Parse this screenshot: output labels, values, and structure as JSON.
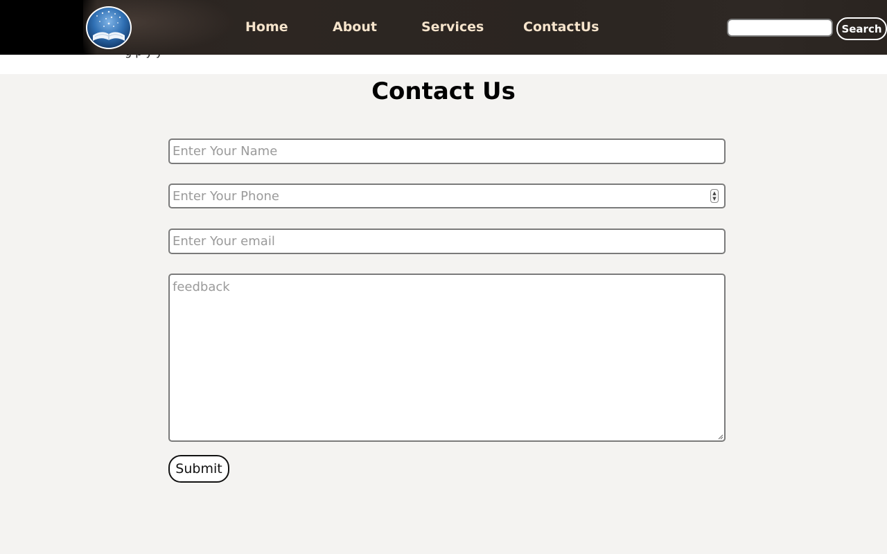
{
  "header": {
    "logo_icon": "open-book-logo-icon",
    "nav": [
      {
        "label": "Home"
      },
      {
        "label": "About"
      },
      {
        "label": "Services"
      },
      {
        "label": "ContactUs"
      }
    ],
    "search": {
      "value": "",
      "placeholder": "",
      "button_label": "Search"
    },
    "text_color": "#f6e4cc"
  },
  "strip_text": "g         p y                           y",
  "page": {
    "title": "Contact Us"
  },
  "form": {
    "name": {
      "placeholder": "Enter Your Name",
      "value": ""
    },
    "phone": {
      "placeholder": "Enter Your Phone",
      "value": ""
    },
    "email": {
      "placeholder": "Enter Your email",
      "value": ""
    },
    "feedback": {
      "placeholder": "feedback",
      "value": ""
    },
    "submit_label": "Submit"
  }
}
